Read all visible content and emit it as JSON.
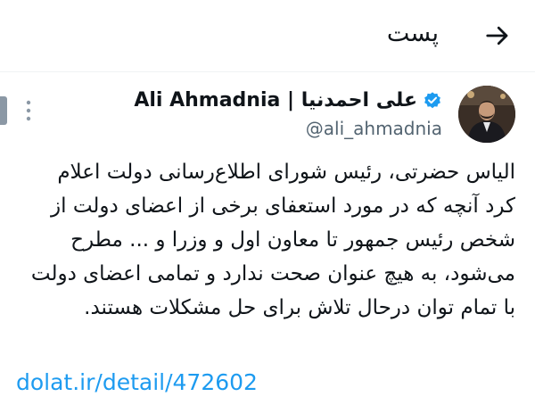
{
  "header": {
    "title": "پست",
    "back_icon": "arrow-right-icon"
  },
  "tweet": {
    "author_name": "Ali Ahmadnia | علی احمدنیا",
    "verified_icon": "verified-badge-icon",
    "verified_color": "#1d9bf0",
    "handle": "@ali_ahmadnia",
    "more_icon": "more-vertical-icon",
    "text_lines": [
      "الیاس حضرتی، رئیس شورای اطلاع‌رسانی دولت اعلام",
      "کرد آنچه که در مورد استعفای برخی از اعضای دولت از",
      "شخص رئیس جمهور تا معاون اول و وزرا و ... مطرح",
      "می‌شود، به هیچ عنوان صحت ندارد و تمامی اعضای دولت",
      "با تمام توان درحال تلاش برای حل مشکلات هستند."
    ],
    "link": "dolat.ir/detail/472602",
    "link_color": "#1d9bf0"
  }
}
